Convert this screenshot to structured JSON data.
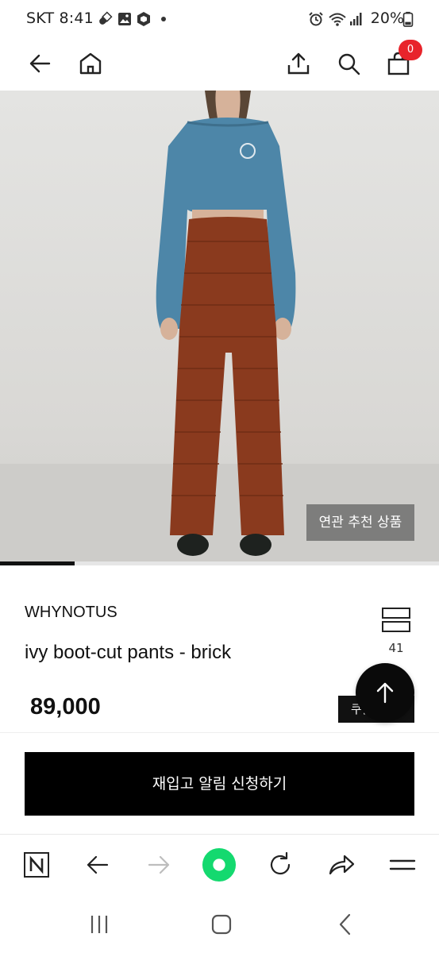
{
  "status_bar": {
    "carrier_time": "SKT 8:41",
    "battery": "20%",
    "icons": [
      "pill-icon",
      "gallery-icon",
      "box-icon",
      "dot-icon",
      "alarm-icon",
      "wifi-icon",
      "signal-icon",
      "battery-icon"
    ]
  },
  "header": {
    "cart_count": "0",
    "icons": [
      "back-arrow-icon",
      "home-icon",
      "share-icon",
      "search-icon",
      "shopping-bag-icon"
    ]
  },
  "product": {
    "image_button": "연관 추천 상품",
    "image_progress": 0.17,
    "brand": "WHYNOTUS",
    "title": "ivy boot-cut pants - brick",
    "like_count": "41",
    "price": "89,000",
    "coupon_label": "쿠폰"
  },
  "cta": {
    "restock_label": "재입고 알림 신청하기"
  },
  "browser_toolbar": {
    "icons": [
      "naver-n-icon",
      "browser-back-icon",
      "browser-forward-icon",
      "green-dot-button-icon",
      "reload-icon",
      "share-arrow-icon",
      "menu-icon"
    ]
  },
  "colors": {
    "accent_green": "#14d96f",
    "badge_red": "#e8242b",
    "sweater_blue": "#4d86a8",
    "pants_brick": "#8a3a1e"
  }
}
